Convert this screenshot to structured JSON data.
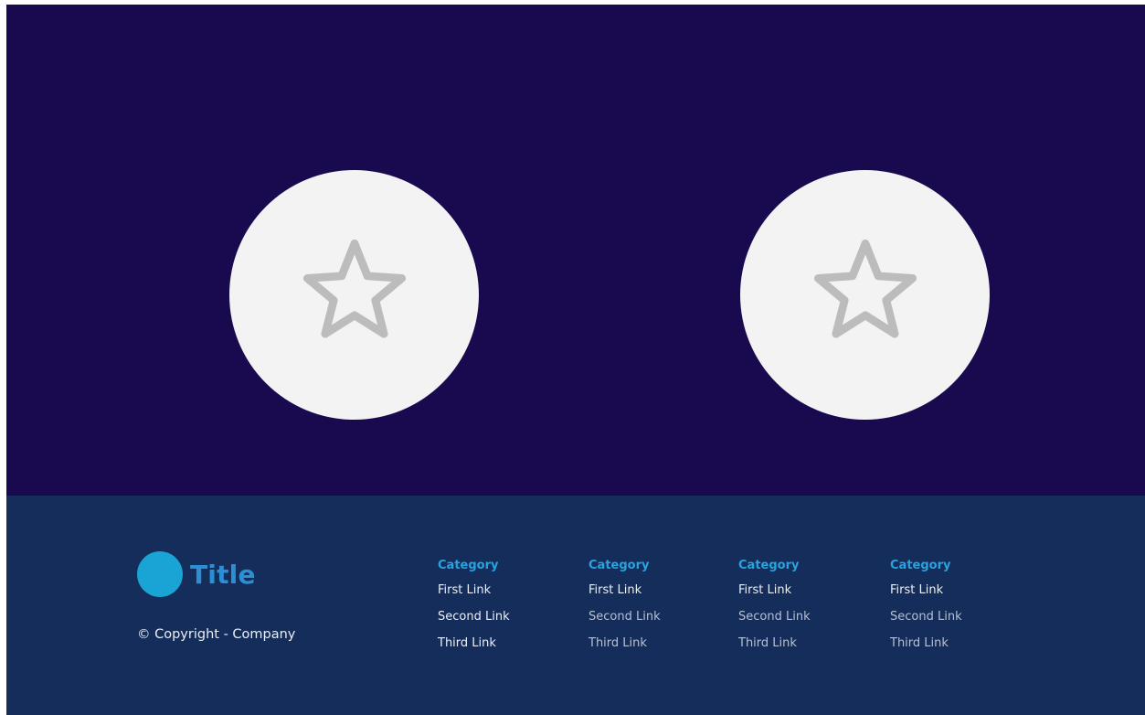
{
  "hero": {
    "features": [
      {
        "icon": "star-icon"
      },
      {
        "icon": "star-icon"
      }
    ]
  },
  "footer": {
    "brand": {
      "title": "Title"
    },
    "copyright": "© Copyright - Company",
    "columns": [
      {
        "title": "Category",
        "links": [
          "First Link",
          "Second Link",
          "Third Link"
        ]
      },
      {
        "title": "Category",
        "links": [
          "First Link",
          "Second Link",
          "Third Link"
        ]
      },
      {
        "title": "Category",
        "links": [
          "First Link",
          "Second Link",
          "Third Link"
        ]
      },
      {
        "title": "Category",
        "links": [
          "First Link",
          "Second Link",
          "Third Link"
        ]
      }
    ]
  },
  "colors": {
    "hero_background": "#190a50",
    "footer_background": "#142d5a",
    "accent": "#27a3df",
    "circle": "#f3f3f3",
    "star_outline": "#bcbcbc"
  }
}
